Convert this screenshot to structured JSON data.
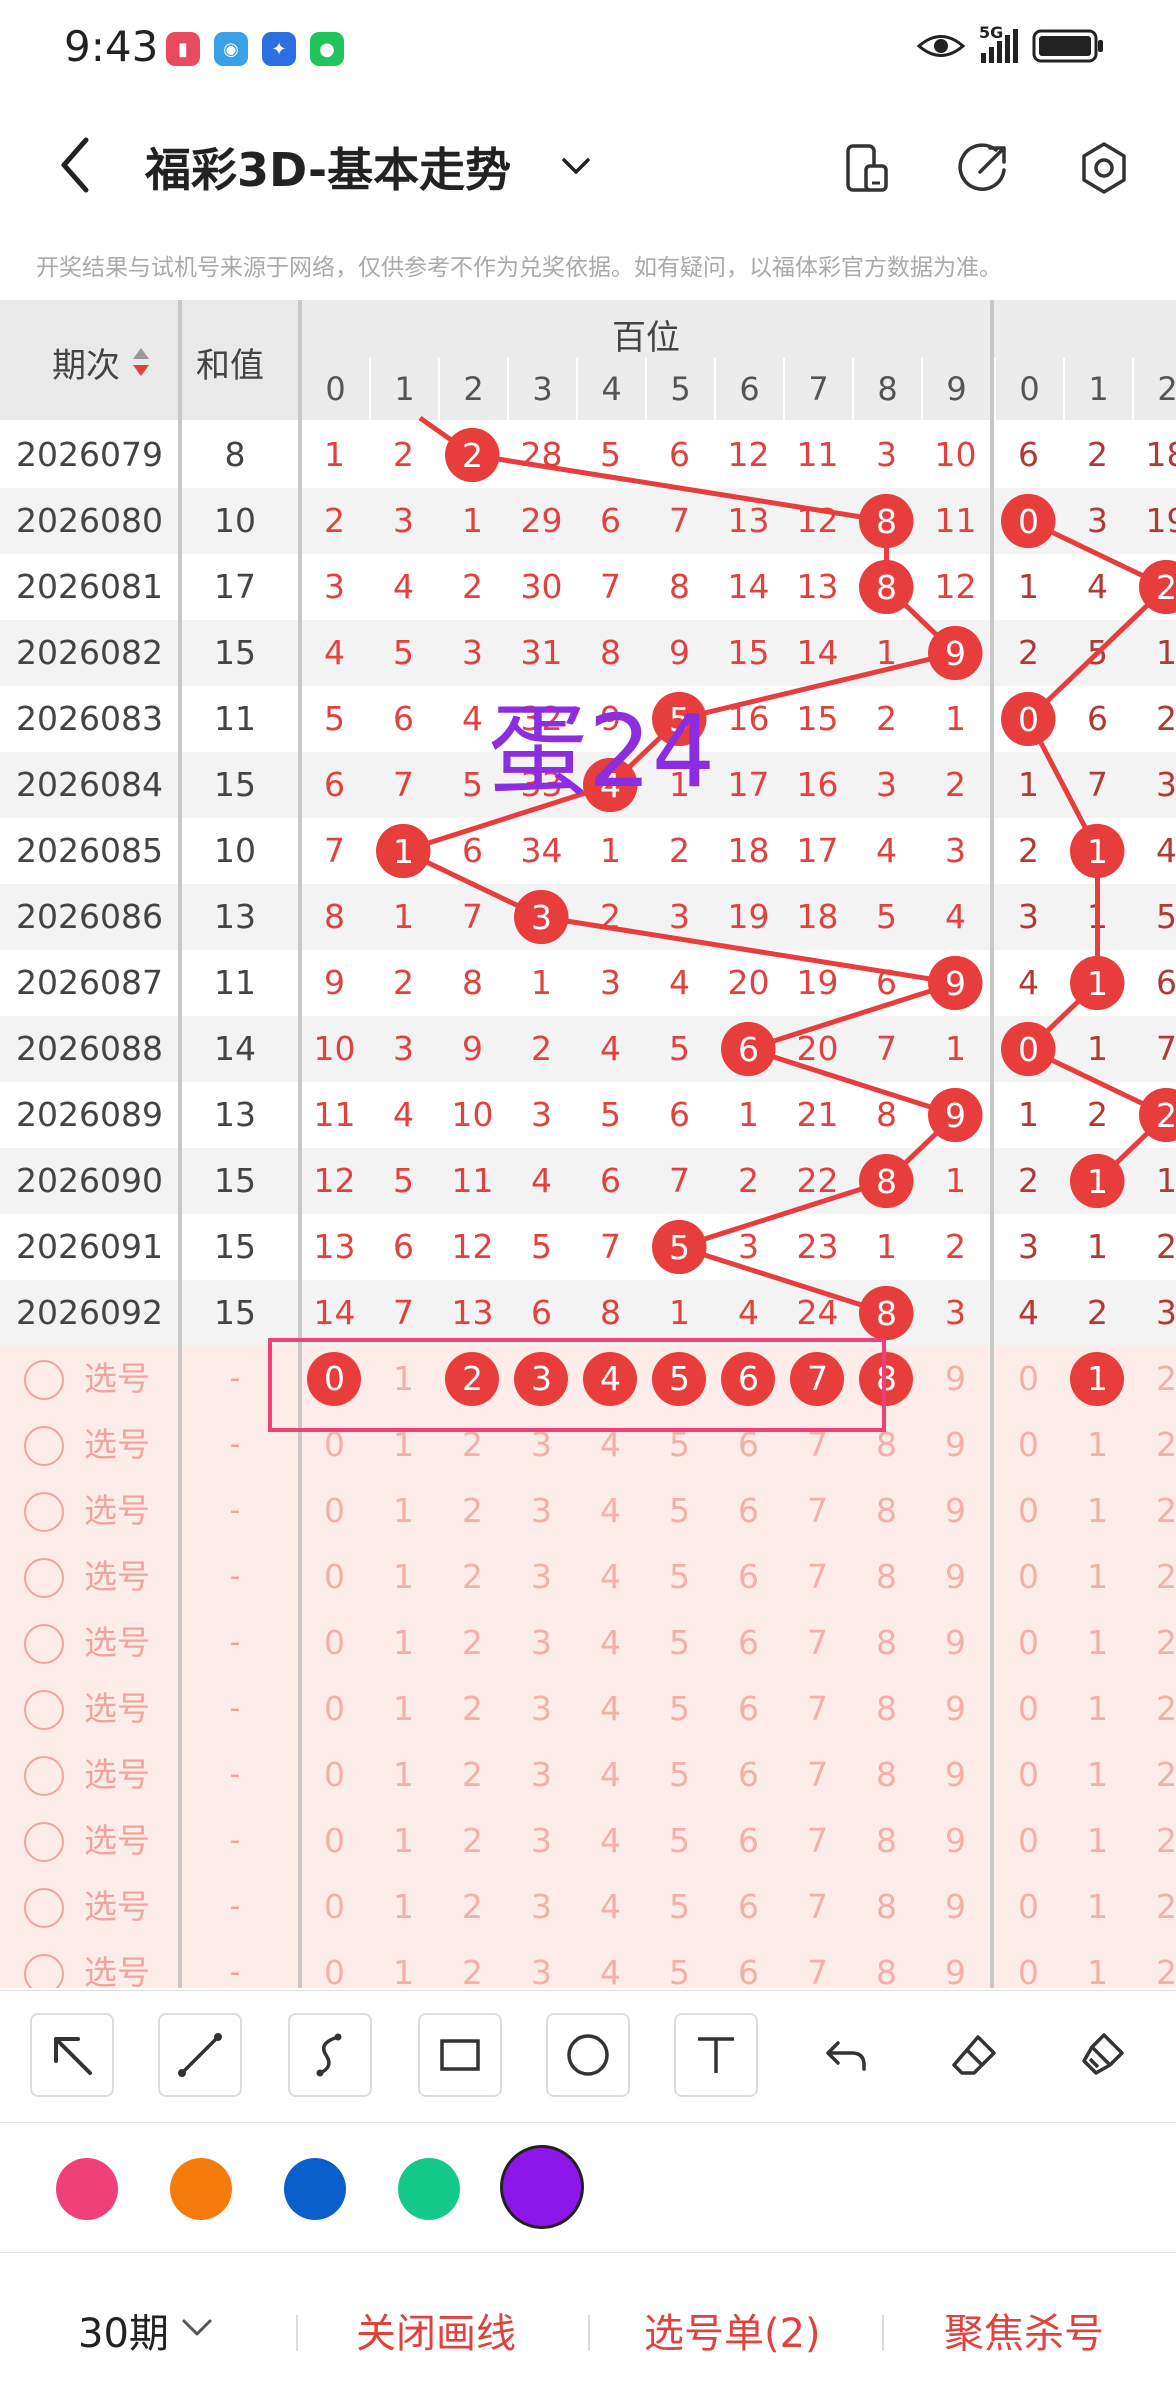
{
  "status": {
    "time": "9:43",
    "network": "5G"
  },
  "header": {
    "title": "福彩3D-基本走势"
  },
  "notice": "开奖结果与试机号来源于网络，仅供参考不作为兑奖依据。如有疑问，以福体彩官方数据为准。",
  "table": {
    "col_issue": "期次",
    "col_sum": "和值",
    "group_label": "百位",
    "digit_headers": [
      "0",
      "1",
      "2",
      "3",
      "4",
      "5",
      "6",
      "7",
      "8",
      "9",
      "0",
      "1",
      "2"
    ],
    "rows": [
      {
        "issue": "2026079",
        "sum": "8",
        "cells": [
          "1",
          "2",
          "2",
          "28",
          "5",
          "6",
          "12",
          "11",
          "3",
          "10",
          "6",
          "2",
          "18"
        ]
      },
      {
        "issue": "2026080",
        "sum": "10",
        "cells": [
          "2",
          "3",
          "1",
          "29",
          "6",
          "7",
          "13",
          "12",
          "8",
          "11",
          "0",
          "3",
          "19"
        ]
      },
      {
        "issue": "2026081",
        "sum": "17",
        "cells": [
          "3",
          "4",
          "2",
          "30",
          "7",
          "8",
          "14",
          "13",
          "8",
          "12",
          "1",
          "4",
          "2"
        ]
      },
      {
        "issue": "2026082",
        "sum": "15",
        "cells": [
          "4",
          "5",
          "3",
          "31",
          "8",
          "9",
          "15",
          "14",
          "1",
          "9",
          "2",
          "5",
          "1"
        ]
      },
      {
        "issue": "2026083",
        "sum": "11",
        "cells": [
          "5",
          "6",
          "4",
          "32",
          "9",
          "5",
          "16",
          "15",
          "2",
          "1",
          "0",
          "6",
          "2"
        ]
      },
      {
        "issue": "2026084",
        "sum": "15",
        "cells": [
          "6",
          "7",
          "5",
          "33",
          "4",
          "1",
          "17",
          "16",
          "3",
          "2",
          "1",
          "7",
          "3"
        ]
      },
      {
        "issue": "2026085",
        "sum": "10",
        "cells": [
          "7",
          "1",
          "6",
          "34",
          "1",
          "2",
          "18",
          "17",
          "4",
          "3",
          "2",
          "1",
          "4"
        ]
      },
      {
        "issue": "2026086",
        "sum": "13",
        "cells": [
          "8",
          "1",
          "7",
          "3",
          "2",
          "3",
          "19",
          "18",
          "5",
          "4",
          "3",
          "1",
          "5"
        ]
      },
      {
        "issue": "2026087",
        "sum": "11",
        "cells": [
          "9",
          "2",
          "8",
          "1",
          "3",
          "4",
          "20",
          "19",
          "6",
          "9",
          "4",
          "1",
          "6"
        ]
      },
      {
        "issue": "2026088",
        "sum": "14",
        "cells": [
          "10",
          "3",
          "9",
          "2",
          "4",
          "5",
          "6",
          "20",
          "7",
          "1",
          "0",
          "1",
          "7"
        ]
      },
      {
        "issue": "2026089",
        "sum": "13",
        "cells": [
          "11",
          "4",
          "10",
          "3",
          "5",
          "6",
          "1",
          "21",
          "8",
          "9",
          "1",
          "2",
          "2"
        ]
      },
      {
        "issue": "2026090",
        "sum": "15",
        "cells": [
          "12",
          "5",
          "11",
          "4",
          "6",
          "7",
          "2",
          "22",
          "8",
          "1",
          "2",
          "1",
          "1"
        ]
      },
      {
        "issue": "2026091",
        "sum": "15",
        "cells": [
          "13",
          "6",
          "12",
          "5",
          "7",
          "5",
          "3",
          "23",
          "1",
          "2",
          "3",
          "1",
          "2"
        ]
      },
      {
        "issue": "2026092",
        "sum": "15",
        "cells": [
          "14",
          "7",
          "13",
          "6",
          "8",
          "1",
          "4",
          "24",
          "8",
          "3",
          "4",
          "2",
          "3"
        ]
      }
    ],
    "pick_label": "选号",
    "pick_dash": "-",
    "pick_digits": [
      "0",
      "1",
      "2",
      "3",
      "4",
      "5",
      "6",
      "7",
      "8",
      "9",
      "0",
      "1",
      "2"
    ]
  },
  "annotation_text": "蛋24",
  "palette": {
    "pink": "#f0407a",
    "orange": "#f57c0a",
    "blue": "#0a5fcc",
    "green": "#14c98a",
    "purple": "#8c17e8"
  },
  "bottom": {
    "period": "30期",
    "close_lines": "关闭画线",
    "pick_list": "选号单(2)",
    "focus_kill": "聚焦杀号"
  },
  "icons": [
    "back-arrow-icon",
    "chevron-down-icon",
    "phone-layout-icon",
    "share-icon",
    "settings-icon",
    "arrow-tool-icon",
    "line-tool-icon",
    "curve-tool-icon",
    "rectangle-tool-icon",
    "circle-tool-icon",
    "text-tool-icon",
    "undo-icon",
    "eraser-icon",
    "clear-all-icon"
  ]
}
